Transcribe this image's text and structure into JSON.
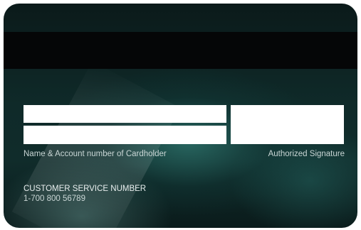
{
  "card": {
    "colors": {
      "card_base": "#0f2a29",
      "card_glow": "#3c968c",
      "magnetic_stripe": "#050607",
      "field_fill": "#ffffff",
      "label_text": "#c9d6d5"
    },
    "cardholder_label": "Name & Account number of Cardholder",
    "signature_label": "Authorized Signature",
    "customer_service": {
      "title": "CUSTOMER SERVICE NUMBER",
      "number": "1-700 800 56789"
    }
  }
}
